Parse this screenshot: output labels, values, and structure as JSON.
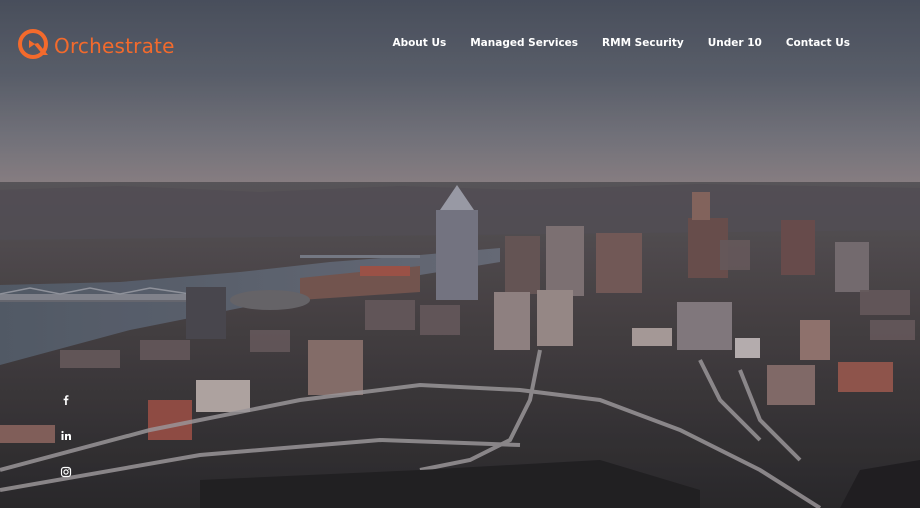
{
  "brand": {
    "name": "Orchestrate",
    "accent": "#f36a2c"
  },
  "nav": {
    "items": [
      {
        "label": "About Us"
      },
      {
        "label": "Managed Services"
      },
      {
        "label": "RMM Security"
      },
      {
        "label": "Under 10"
      },
      {
        "label": "Contact Us"
      }
    ],
    "text_color": "#ffffff"
  },
  "hero": {
    "background": "aerial-city-photo"
  },
  "social": {
    "icons": [
      "facebook-icon",
      "linkedin-icon",
      "instagram-icon"
    ]
  }
}
